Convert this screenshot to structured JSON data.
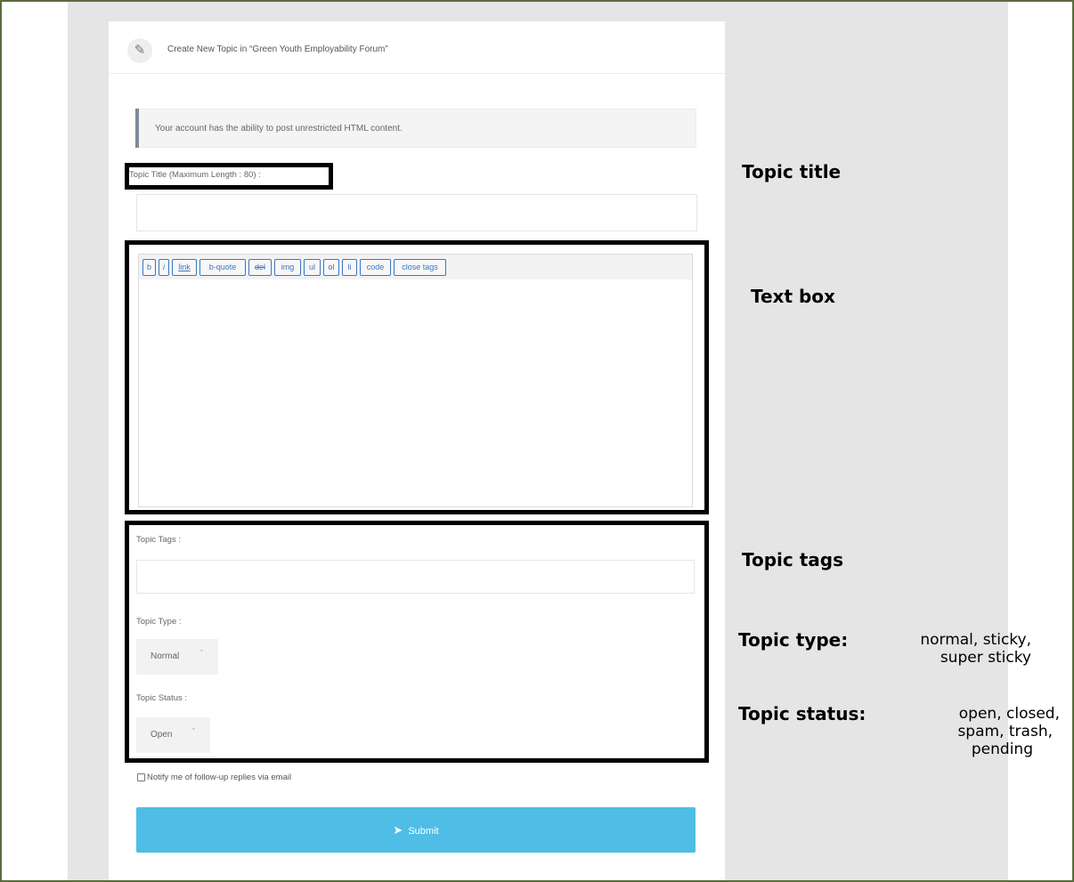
{
  "header": {
    "title": "Create New Topic in “Green Youth Employability Forum”",
    "icon": "pencil-icon"
  },
  "notice": {
    "text": "Your account has the ability to post unrestricted HTML content."
  },
  "form": {
    "title_label": "Topic Title (Maximum Length : 80) :",
    "title_value": "",
    "toolbar": [
      "b",
      "i",
      "link",
      "b-quote",
      "del",
      "img",
      "ul",
      "ol",
      "li",
      "code",
      "close tags"
    ],
    "body_value": "",
    "tags_label": "Topic Tags :",
    "tags_value": "",
    "type_label": "Topic Type :",
    "type_selected": "Normal",
    "status_label": "Topic Status :",
    "status_selected": "Open",
    "notify_label": "Notify me of follow-up replies via email",
    "notify_checked": false,
    "submit_label": "Submit",
    "submit_icon": "paper-plane-icon"
  },
  "annotations": {
    "topic_title": "Topic title",
    "text_box": "Text box",
    "topic_tags": "Topic tags",
    "topic_type": "Topic type:",
    "topic_type_options_1": "normal, sticky,",
    "topic_type_options_2": "super sticky",
    "topic_status": "Topic status:",
    "topic_status_options_1": "open, closed,",
    "topic_status_options_2": "spam, trash,",
    "topic_status_options_3": "pending"
  },
  "colors": {
    "frame_border": "#5a6b3e",
    "background_gray": "#e5e5e5",
    "submit_blue": "#4fbde6",
    "toolbar_link_blue": "#3b78c4",
    "highlight_box": "#000000"
  }
}
